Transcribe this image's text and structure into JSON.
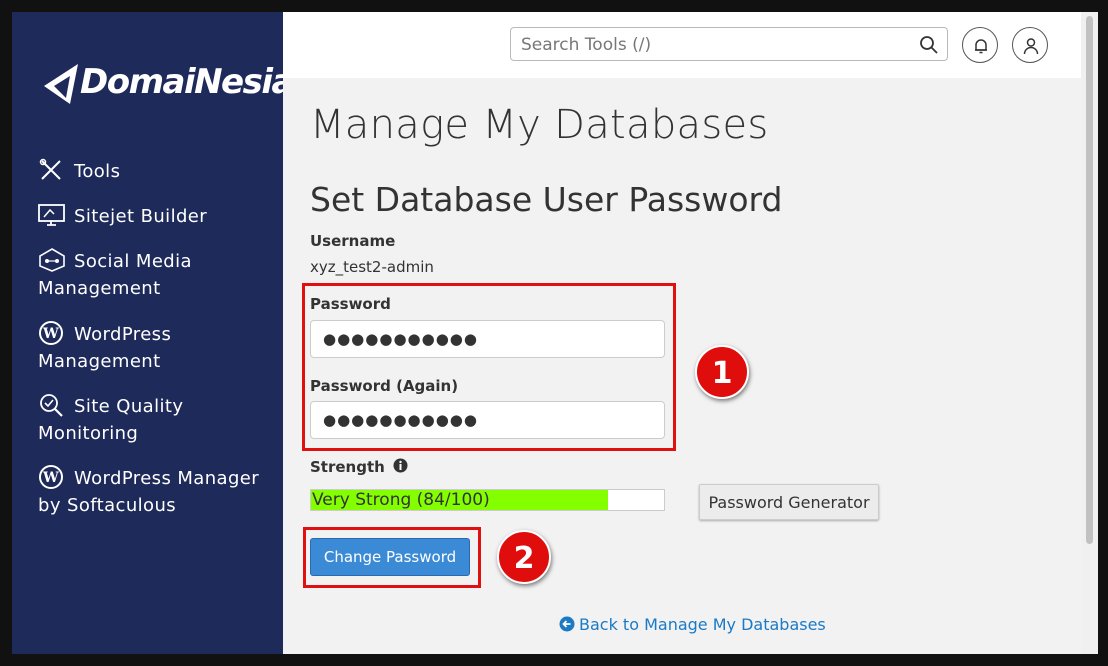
{
  "brand": {
    "logo_text": "DomaiNesia"
  },
  "sidebar": {
    "items": [
      {
        "label": "Tools",
        "icon": "tools-icon"
      },
      {
        "label": "Sitejet Builder",
        "icon": "monitor-icon"
      },
      {
        "label": "Social Media Management",
        "icon": "social-media-icon"
      },
      {
        "label": "WordPress Management",
        "icon": "wordpress-icon"
      },
      {
        "label": "Site Quality Monitoring",
        "icon": "magnifier-check-icon"
      },
      {
        "label": "WordPress Manager by Softaculous",
        "icon": "wordpress-icon"
      }
    ]
  },
  "topbar": {
    "search_placeholder": "Search Tools (/)",
    "search_icon": "search-icon",
    "notifications_icon": "bell-icon",
    "user_icon": "user-icon"
  },
  "page": {
    "title": "Manage My Databases",
    "section_title": "Set Database User Password",
    "username_label": "Username",
    "username_value": "xyz_test2-admin",
    "password_label": "Password",
    "password_value": "●●●●●●●●●●●",
    "password_again_label": "Password (Again)",
    "password_again_value": "●●●●●●●●●●●",
    "strength_label": "Strength",
    "strength_text": "Very Strong (84/100)",
    "strength_score": 84,
    "strength_color": "#84ff00",
    "password_generator_label": "Password Generator",
    "change_password_label": "Change Password",
    "back_link_label": "Back to Manage My Databases"
  },
  "annotations": {
    "badge1": "1",
    "badge2": "2",
    "color": "#e01010"
  },
  "colors": {
    "sidebar_bg": "#1e2a5a",
    "primary_button": "#3a8ad6",
    "link": "#1a7ac6"
  }
}
